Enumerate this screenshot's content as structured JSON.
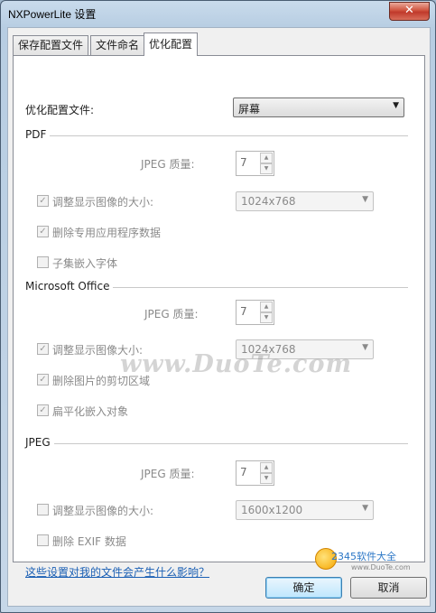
{
  "window": {
    "title": "NXPowerLite 设置",
    "close_glyph": "✕"
  },
  "tabs": [
    {
      "label": "保存配置文件"
    },
    {
      "label": "文件命名"
    },
    {
      "label": "优化配置"
    }
  ],
  "profile": {
    "label": "优化配置文件:",
    "value": "屏幕"
  },
  "pdf": {
    "section": "PDF",
    "jpeg_label": "JPEG 质量:",
    "jpeg_value": "7",
    "resize_label": "调整显示图像的大小:",
    "resize_value": "1024x768",
    "remove_label": "删除专用应用程序数据",
    "subset_label": "子集嵌入字体"
  },
  "office": {
    "section": "Microsoft Office",
    "jpeg_label": "JPEG 质量:",
    "jpeg_value": "7",
    "resize_label": "调整显示图像大小:",
    "resize_value": "1024x768",
    "crop_label": "删除图片的剪切区域",
    "flatten_label": "扁平化嵌入对象"
  },
  "jpeg": {
    "section": "JPEG",
    "jpeg_label": "JPEG 质量:",
    "jpeg_value": "7",
    "resize_label": "调整显示图像的大小:",
    "resize_value": "1600x1200",
    "exif_label": "删除 EXIF 数据"
  },
  "help_link": "这些设置对我的文件会产生什么影响？",
  "buttons": {
    "ok": "确定",
    "cancel": "取消"
  },
  "watermark": "www.DuoTe.com",
  "corner_logo": {
    "brand": "2345软件大全",
    "url": "www.DuoTe.com"
  },
  "glyphs": {
    "check": "✓",
    "dropdown": "▼",
    "spin_up": "▲",
    "spin_down": "▼"
  }
}
